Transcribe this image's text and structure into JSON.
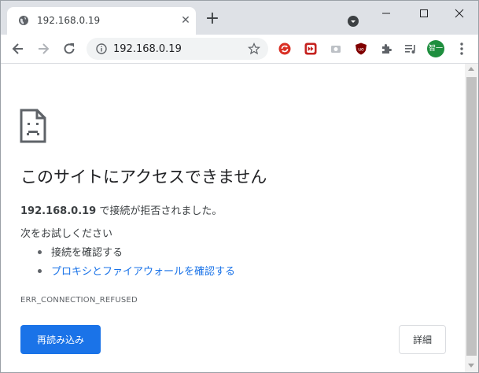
{
  "browser": {
    "tab": {
      "title": "192.168.0.19",
      "favicon": "globe-icon"
    },
    "new_tab": "+",
    "window_controls": {
      "minimize": "—",
      "maximize": "☐",
      "close": "✕"
    },
    "address_bar": {
      "url": "192.168.0.19"
    },
    "avatar_text": "智一",
    "extensions": [
      "sync-extension-icon",
      "fast-forward-extension-icon",
      "camera-extension-icon",
      "ublock-extension-icon",
      "puzzle-extensions-icon",
      "media-control-icon"
    ]
  },
  "error_page": {
    "heading": "このサイトにアクセスできません",
    "description": {
      "host": "192.168.0.19",
      "text": " で接続が拒否されました。"
    },
    "try_label": "次をお試しください",
    "suggestions": [
      "接続を確認する",
      "プロキシとファイアウォールを確認する"
    ],
    "error_code": "ERR_CONNECTION_REFUSED",
    "reload_button": "再読み込み",
    "details_button": "詳細"
  },
  "colors": {
    "accent": "#1a73e8",
    "titlebar": "#dee1e6",
    "omnibox": "#f1f3f4",
    "avatar": "#1e8e3e"
  }
}
